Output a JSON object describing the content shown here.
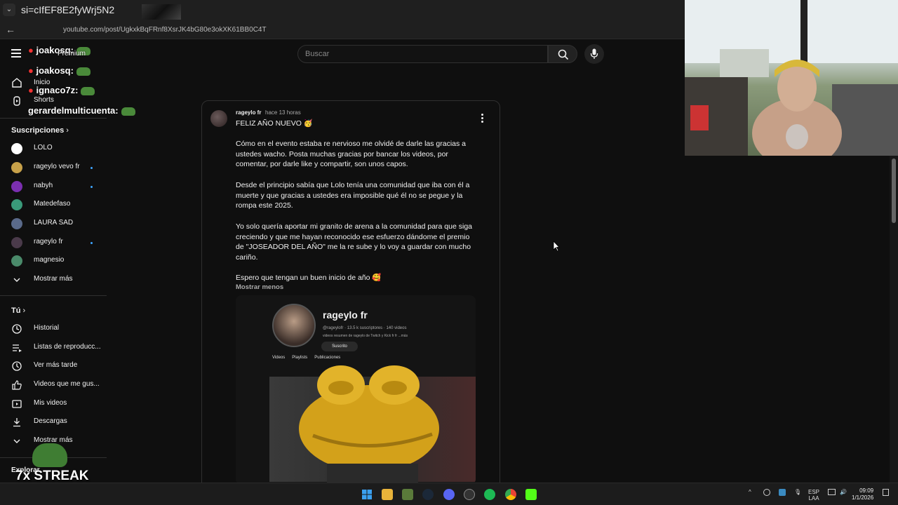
{
  "browser": {
    "tab_title": "si=cIfEF8E2fyWrj5N2",
    "url": "youtube.com/post/UgkxkBqFRnf8XsrJK4bG80e3okXK61BB0C4T"
  },
  "chat_overlay": [
    {
      "user": "joakosq:"
    },
    {
      "user": "joakosq:"
    },
    {
      "user": "ignaco7z:"
    },
    {
      "user": "gerardelmulticuenta:"
    }
  ],
  "streak_text": "7x STREAK",
  "header": {
    "premium_label": "Premium",
    "search_placeholder": "Buscar"
  },
  "sidebar": {
    "nav": [
      {
        "label": "Inicio"
      },
      {
        "label": "Shorts"
      }
    ],
    "subscriptions_title": "Suscripciones",
    "subscriptions": [
      {
        "label": "LOLO",
        "color": "#ffffff",
        "new": false
      },
      {
        "label": "rageylo vevo fr",
        "color": "#c7a14a",
        "new": true
      },
      {
        "label": "nabyh",
        "color": "#7b2fb0",
        "new": true
      },
      {
        "label": "Matedefaso",
        "color": "#3a9a7a",
        "new": false
      },
      {
        "label": "LAURA SAD",
        "color": "#5a6a8a",
        "new": false
      },
      {
        "label": "rageylo fr",
        "color": "#4a3a4a",
        "new": true
      },
      {
        "label": "magnesio",
        "color": "#4a8a6a",
        "new": false
      }
    ],
    "subs_more": "Mostrar más",
    "you_title": "Tú",
    "you_items": [
      {
        "label": "Historial"
      },
      {
        "label": "Listas de reproducc..."
      },
      {
        "label": "Ver más tarde"
      },
      {
        "label": "Videos que me gus..."
      },
      {
        "label": "Mis videos"
      },
      {
        "label": "Descargas"
      },
      {
        "label": "Mostrar más"
      }
    ],
    "explore_title": "Explorar"
  },
  "post": {
    "author": "rageylo fr",
    "time": "hace 13 horas",
    "title": "FELIZ AÑO NUEVO 🥳",
    "paragraphs": [
      "Cómo en el evento estaba re nervioso me olvidé de darle las gracias a ustedes wacho. Posta muchas gracias por bancar los videos, por comentar, por darle like y compartir, son unos capos.",
      "Desde el principio sabía que Lolo tenía una comunidad que iba con él a muerte y que gracias a ustedes era imposible qué él no se pegue y la rompa este 2025.",
      "Yo solo quería aportar mi granito de arena a la comunidad para que siga creciendo y que me hayan reconocido ese esfuerzo dándome el premio de \"JOSEADOR DEL AÑO\" me la re sube y lo voy a guardar con mucho cariño.",
      "Espero que tengan un buen inicio de año 🥰"
    ],
    "show_less": "Mostrar menos",
    "image": {
      "channel_name": "rageylo fr",
      "channel_stats": "@rageylofr · 13.5 k suscriptores · 140 videos",
      "channel_desc": "videos resumen de rageylo de Twitch y Kick fr fr ...más",
      "subscribe_label": "Suscrito",
      "tabs": [
        "Videos",
        "Playlists",
        "Publicaciones"
      ]
    }
  },
  "taskbar": {
    "lang_top": "ESP",
    "lang_bottom": "LAA",
    "time": "09:09",
    "date": "1/1/2026"
  }
}
